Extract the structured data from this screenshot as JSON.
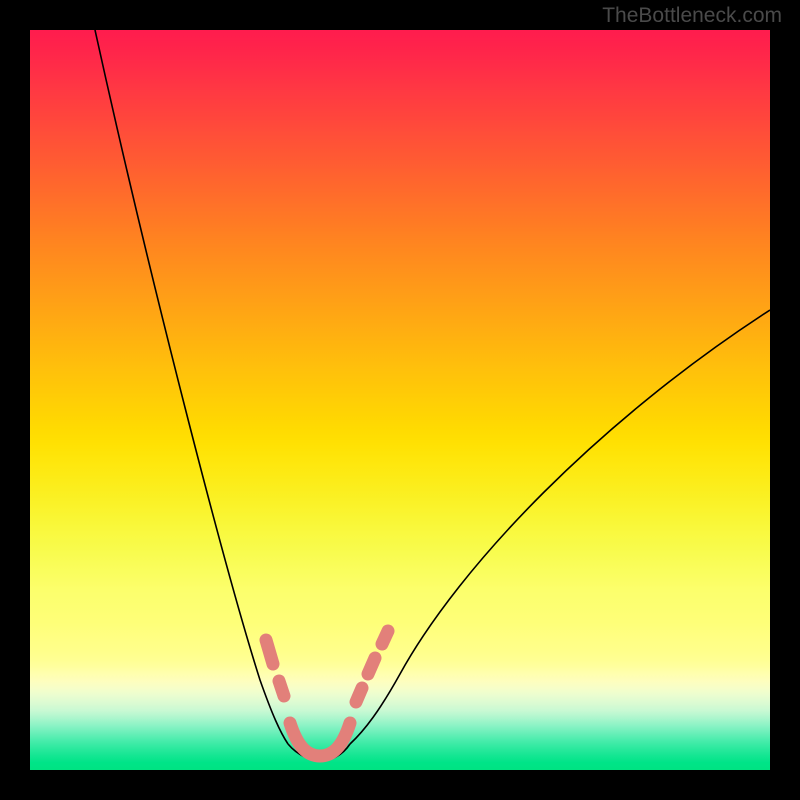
{
  "watermark": "TheBottleneck.com",
  "chart_data": {
    "type": "line",
    "title": "",
    "xlabel": "",
    "ylabel": "",
    "description": "Bottleneck curve on a red-to-green vertical gradient background. Two black curves form a V with the minimum near x≈0.39. Salmon-colored rounded markers highlight the region near the minimum.",
    "xlim": [
      0,
      1
    ],
    "ylim": [
      0,
      1
    ],
    "series": [
      {
        "name": "left-branch",
        "x": [
          0.09,
          0.15,
          0.2,
          0.25,
          0.3,
          0.33,
          0.35
        ],
        "y": [
          1.0,
          0.7,
          0.48,
          0.3,
          0.15,
          0.07,
          0.02
        ]
      },
      {
        "name": "right-branch",
        "x": [
          0.43,
          0.46,
          0.5,
          0.55,
          0.65,
          0.8,
          1.0
        ],
        "y": [
          0.02,
          0.07,
          0.13,
          0.2,
          0.35,
          0.5,
          0.62
        ]
      }
    ],
    "highlight_markers": {
      "color": "#e2807a",
      "x": [
        0.32,
        0.34,
        0.36,
        0.38,
        0.4,
        0.42,
        0.44,
        0.46,
        0.48
      ],
      "y": [
        0.17,
        0.12,
        0.06,
        0.02,
        0.01,
        0.02,
        0.06,
        0.12,
        0.18
      ]
    },
    "gradient_stops": [
      {
        "pos": 0.0,
        "color": "#ff1c4e"
      },
      {
        "pos": 0.25,
        "color": "#ff7a24"
      },
      {
        "pos": 0.5,
        "color": "#ffce06"
      },
      {
        "pos": 0.75,
        "color": "#fcff6d"
      },
      {
        "pos": 0.92,
        "color": "#c8f9d3"
      },
      {
        "pos": 1.0,
        "color": "#00e382"
      }
    ]
  }
}
